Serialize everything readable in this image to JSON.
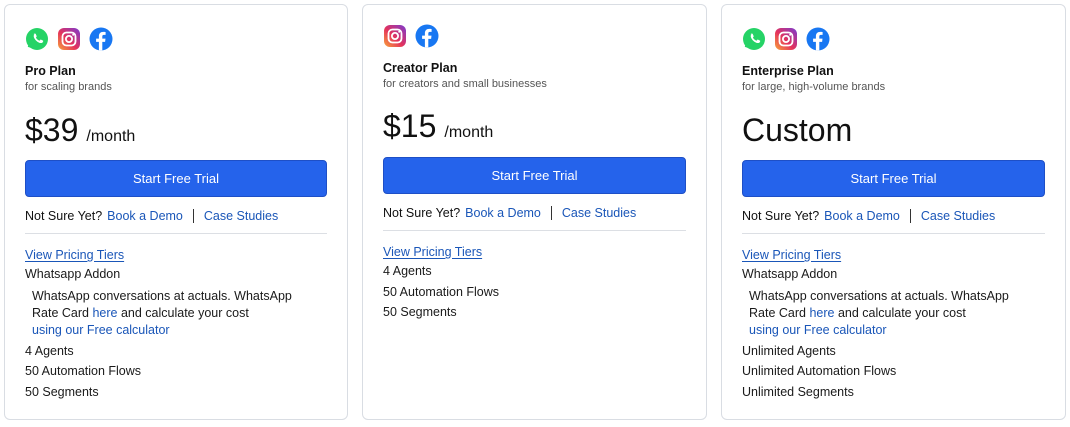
{
  "colors": {
    "primary_button": "#2563eb",
    "link": "#1a56b8",
    "card_border": "#d9dde3"
  },
  "icon_names": [
    "whatsapp-icon",
    "instagram-icon",
    "facebook-icon"
  ],
  "plans": [
    {
      "icons": [
        "whatsapp",
        "instagram",
        "facebook"
      ],
      "name": "Pro Plan",
      "subtitle": "for scaling brands",
      "price": "$39",
      "period": "/month",
      "cta": "Start Free Trial",
      "not_sure": "Not Sure Yet?",
      "book_demo": "Book a Demo",
      "case_studies": "Case Studies",
      "pricing_tiers": "View Pricing Tiers",
      "addon_title": "Whatsapp Addon",
      "addon_desc_1": "WhatsApp conversations at actuals. WhatsApp",
      "addon_desc_2a": "Rate Card ",
      "addon_here": "here",
      "addon_desc_2b": " and calculate your cost",
      "addon_calc": "using our Free calculator",
      "features": [
        "4 Agents",
        "50 Automation Flows",
        "50 Segments"
      ]
    },
    {
      "icons": [
        "instagram",
        "facebook"
      ],
      "name": "Creator Plan",
      "subtitle": "for creators and small businesses",
      "price": "$15",
      "period": "/month",
      "cta": "Start Free Trial",
      "not_sure": "Not Sure Yet?",
      "book_demo": "Book a Demo",
      "case_studies": "Case Studies",
      "pricing_tiers": "View Pricing Tiers",
      "features": [
        "4 Agents",
        "50 Automation Flows",
        "50 Segments"
      ]
    },
    {
      "icons": [
        "whatsapp",
        "instagram",
        "facebook"
      ],
      "name": "Enterprise Plan",
      "subtitle": "for large, high-volume brands",
      "price": "Custom",
      "period": "",
      "cta": "Start Free Trial",
      "not_sure": "Not Sure Yet?",
      "book_demo": "Book a Demo",
      "case_studies": "Case Studies",
      "pricing_tiers": "View Pricing Tiers",
      "addon_title": "Whatsapp Addon",
      "addon_desc_1": "WhatsApp conversations at actuals. WhatsApp",
      "addon_desc_2a": "Rate Card ",
      "addon_here": "here",
      "addon_desc_2b": " and calculate your cost",
      "addon_calc": "using our Free calculator",
      "features": [
        "Unlimited Agents",
        "Unlimited Automation Flows",
        "Unlimited Segments"
      ]
    }
  ]
}
